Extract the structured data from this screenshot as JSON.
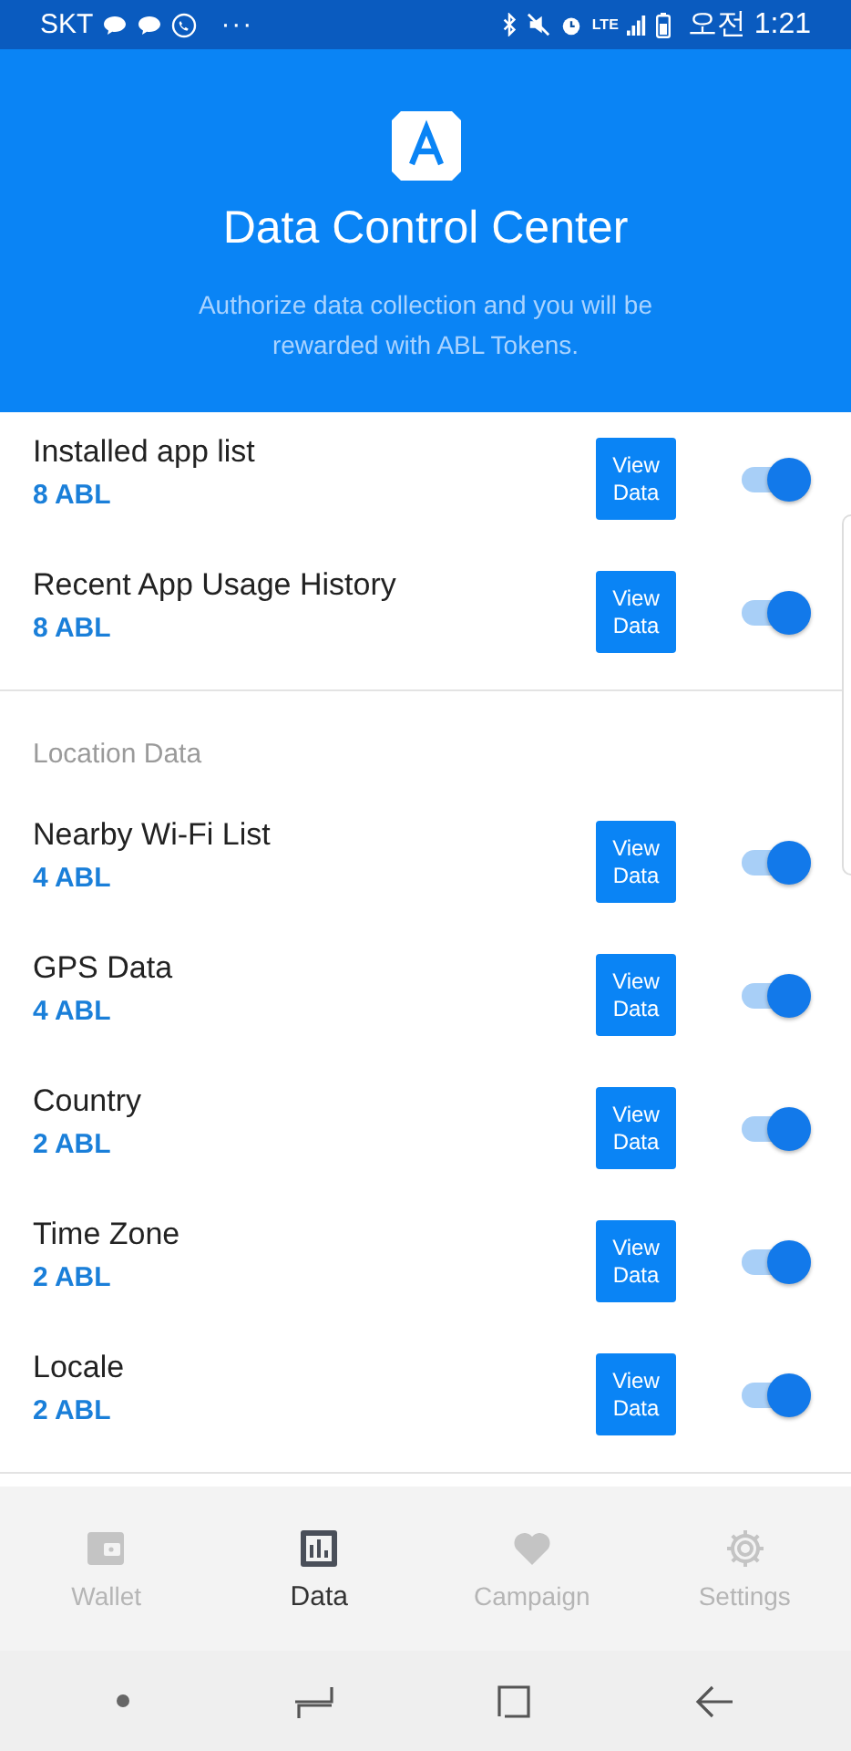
{
  "status_bar": {
    "carrier": "SKT",
    "more": "···",
    "network": "LTE",
    "time": "오전 1:21"
  },
  "header": {
    "title": "Data Control Center",
    "subtitle": "Authorize data collection and you will be rewarded with ABL Tokens."
  },
  "sections": [
    {
      "items": [
        {
          "name": "Installed app list",
          "reward": "8 ABL",
          "button": "View Data",
          "on": true
        },
        {
          "name": "Recent App Usage History",
          "reward": "8 ABL",
          "button": "View Data",
          "on": true
        }
      ]
    },
    {
      "title": "Location Data",
      "items": [
        {
          "name": "Nearby Wi-Fi List",
          "reward": "4 ABL",
          "button": "View Data",
          "on": true
        },
        {
          "name": "GPS Data",
          "reward": "4 ABL",
          "button": "View Data",
          "on": true
        },
        {
          "name": "Country",
          "reward": "2 ABL",
          "button": "View Data",
          "on": true
        },
        {
          "name": "Time Zone",
          "reward": "2 ABL",
          "button": "View Data",
          "on": true
        },
        {
          "name": "Locale",
          "reward": "2 ABL",
          "button": "View Data",
          "on": true
        }
      ]
    }
  ],
  "tabs": [
    {
      "kind": "wallet",
      "label": "Wallet",
      "selected": false
    },
    {
      "kind": "chart",
      "label": "Data",
      "selected": true
    },
    {
      "kind": "heart",
      "label": "Campaign",
      "selected": false
    },
    {
      "kind": "gear",
      "label": "Settings",
      "selected": false
    }
  ]
}
